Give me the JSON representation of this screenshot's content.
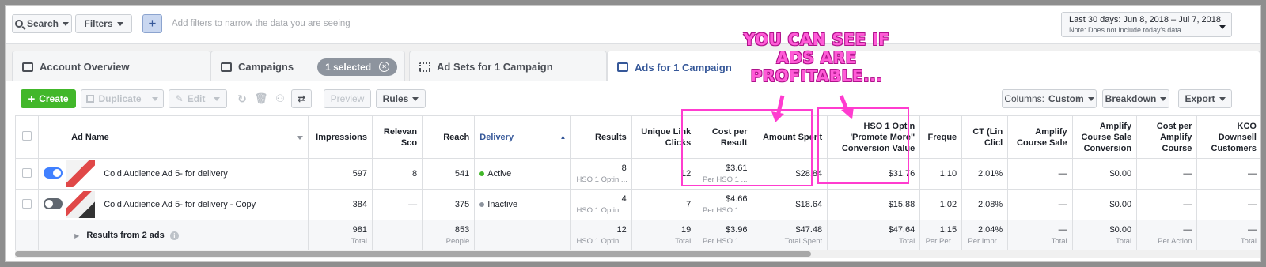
{
  "filterbar": {
    "search_label": "Search",
    "filters_label": "Filters",
    "placeholder": "Add filters to narrow the data you are seeing",
    "date_range": "Last 30 days: Jun 8, 2018 – Jul 7, 2018",
    "date_note": "Note: Does not include today's data"
  },
  "tabs": {
    "account": "Account Overview",
    "campaigns": "Campaigns",
    "selected": "1 selected",
    "adsets": "Ad Sets for 1 Campaign",
    "ads": "Ads for 1 Campaign"
  },
  "toolbar": {
    "create": "Create",
    "duplicate": "Duplicate",
    "edit": "Edit",
    "preview": "Preview",
    "rules": "Rules",
    "columns_prefix": "Columns:",
    "columns_value": "Custom",
    "breakdown": "Breakdown",
    "export": "Export"
  },
  "columns": {
    "ad_name": "Ad Name",
    "impressions": "Impressions",
    "relevance": "Relevan Sco",
    "reach": "Reach",
    "delivery": "Delivery",
    "results": "Results",
    "unique_link_clicks": "Unique Link Clicks",
    "cost_per_result": "Cost per Result",
    "amount_spent": "Amount Spent",
    "conversion_value": "HSO 1 Optin 'Promote More\" Conversion Value",
    "frequency": "Freque",
    "ctr": "CT (Lin Clicl",
    "amplify_sale": "Amplify Course Sale",
    "amplify_conversion": "Amplify Course Sale Conversion",
    "cost_amplify": "Cost per Amplify Course",
    "kco": "KCO Downsell Customers"
  },
  "rows": [
    {
      "name": "Cold Audience Ad 5- for delivery",
      "impressions": "597",
      "relevance": "8",
      "reach": "541",
      "delivery": "Active",
      "results": "8",
      "results_sub": "HSO 1 Optin ...",
      "unique_link_clicks": "12",
      "cost_per_result": "$3.61",
      "cost_sub": "Per HSO 1 ...",
      "amount_spent": "$28.84",
      "conversion_value": "$31.76",
      "frequency": "1.10",
      "ctr": "2.01%",
      "amplify_sale": "—",
      "amplify_conversion": "$0.00",
      "cost_amplify": "—",
      "kco": "—"
    },
    {
      "name": "Cold Audience Ad 5- for delivery - Copy",
      "impressions": "384",
      "relevance": "—",
      "reach": "375",
      "delivery": "Inactive",
      "results": "4",
      "results_sub": "HSO 1 Optin ...",
      "unique_link_clicks": "7",
      "cost_per_result": "$4.66",
      "cost_sub": "Per HSO 1 ...",
      "amount_spent": "$18.64",
      "conversion_value": "$15.88",
      "frequency": "1.02",
      "ctr": "2.08%",
      "amplify_sale": "—",
      "amplify_conversion": "$0.00",
      "cost_amplify": "—",
      "kco": "—"
    }
  ],
  "totals": {
    "label": "Results from 2 ads",
    "impressions": "981",
    "impressions_sub": "Total",
    "reach": "853",
    "reach_sub": "People",
    "results": "12",
    "results_sub": "HSO 1 Optin ...",
    "unique_link_clicks": "19",
    "ulc_sub": "Total",
    "cost_per_result": "$3.96",
    "cost_sub": "Per HSO 1 ...",
    "amount_spent": "$47.48",
    "spent_sub": "Total Spent",
    "conversion_value": "$47.64",
    "conv_sub": "Total",
    "frequency": "1.15",
    "freq_sub": "Per Per...",
    "ctr": "2.04%",
    "ctr_sub": "Per Impr...",
    "amplify_sale": "—",
    "amplify_sale_sub": "Total",
    "amplify_conversion": "$0.00",
    "amplify_conversion_sub": "Total",
    "cost_amplify": "—",
    "cost_amplify_sub": "Per Action",
    "kco": "—",
    "kco_sub": "Total"
  },
  "annotation": {
    "line1": "YOU CAN SEE IF",
    "line2": "ADS ARE",
    "line3": "PROFITABLE..."
  },
  "colors": {
    "create_green": "#42b72a",
    "link_blue": "#365899",
    "annotation_pink": "#ff3ccf"
  }
}
